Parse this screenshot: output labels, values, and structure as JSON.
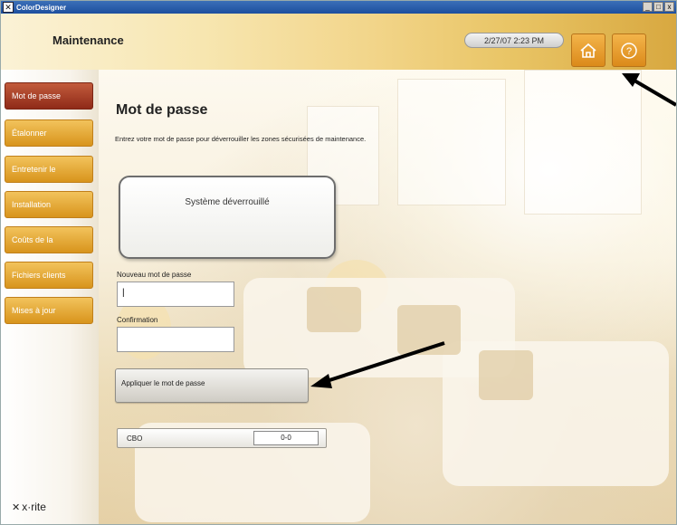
{
  "window": {
    "title": "ColorDesigner",
    "controls": [
      "_",
      "□",
      "x"
    ]
  },
  "header": {
    "title": "Maintenance",
    "datetime": "2/27/07 2:23 PM"
  },
  "sidebar": {
    "items": [
      {
        "label": "Mot de passe",
        "active": true
      },
      {
        "label": "Étalonner",
        "active": false
      },
      {
        "label": "Entretenir le",
        "active": false
      },
      {
        "label": "Installation",
        "active": false
      },
      {
        "label": "Coûts de la",
        "active": false
      },
      {
        "label": "Fichiers clients",
        "active": false
      },
      {
        "label": "Mises à jour",
        "active": false
      }
    ],
    "brand": "x·rite"
  },
  "main": {
    "page_title": "Mot de passe",
    "instructions": "Entrez votre mot de passe pour déverrouiller les zones sécurisées de maintenance.",
    "status": "Système déverrouillé",
    "new_password_label": "Nouveau mot de passe",
    "new_password_value": "|",
    "confirm_label": "Confirmation",
    "confirm_value": "",
    "apply_button": "Appliquer le mot de passe",
    "cbo_label": "CBO",
    "cbo_value": "0-0"
  },
  "colors": {
    "accent_orange": "#e29a2a",
    "active_red": "#a33b24"
  }
}
